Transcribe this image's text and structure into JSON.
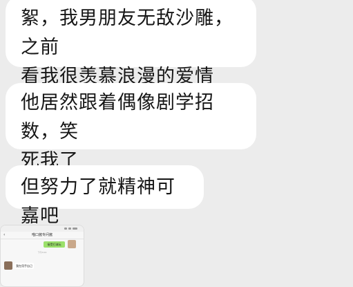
{
  "messages": [
    {
      "id": "m1",
      "line1": "絮，我男朋友无敌沙雕，之前",
      "line2": "看我很羡慕浪漫的爱情"
    },
    {
      "id": "m2",
      "line1": "他居然跟着偶像剧学招数，笑",
      "line2": "死我了"
    },
    {
      "id": "m3",
      "line1": "但努力了就精神可嘉吧"
    }
  ],
  "thumbnail": {
    "title": "喵口酱专问酱",
    "back_glyph": "‹",
    "outgoing_text": "接受打球玩",
    "time_text": "下午3:00",
    "incoming_text": "我在用手自己"
  },
  "colors": {
    "background": "#ececec",
    "bubble": "#ffffff",
    "outgoing_bubble": "#9be06a"
  }
}
